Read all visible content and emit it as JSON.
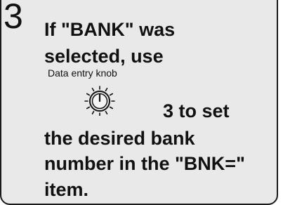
{
  "step": {
    "number": "3",
    "line1": "If \"BANK\" was",
    "line2": "selected, use",
    "knob_label": "Data entry knob",
    "knob_suffix": "3 to set",
    "line4": "the desired bank",
    "line5": "number in the \"BNK=\"",
    "line6": "item."
  },
  "icons": {
    "knob": "data-entry-knob-icon"
  }
}
